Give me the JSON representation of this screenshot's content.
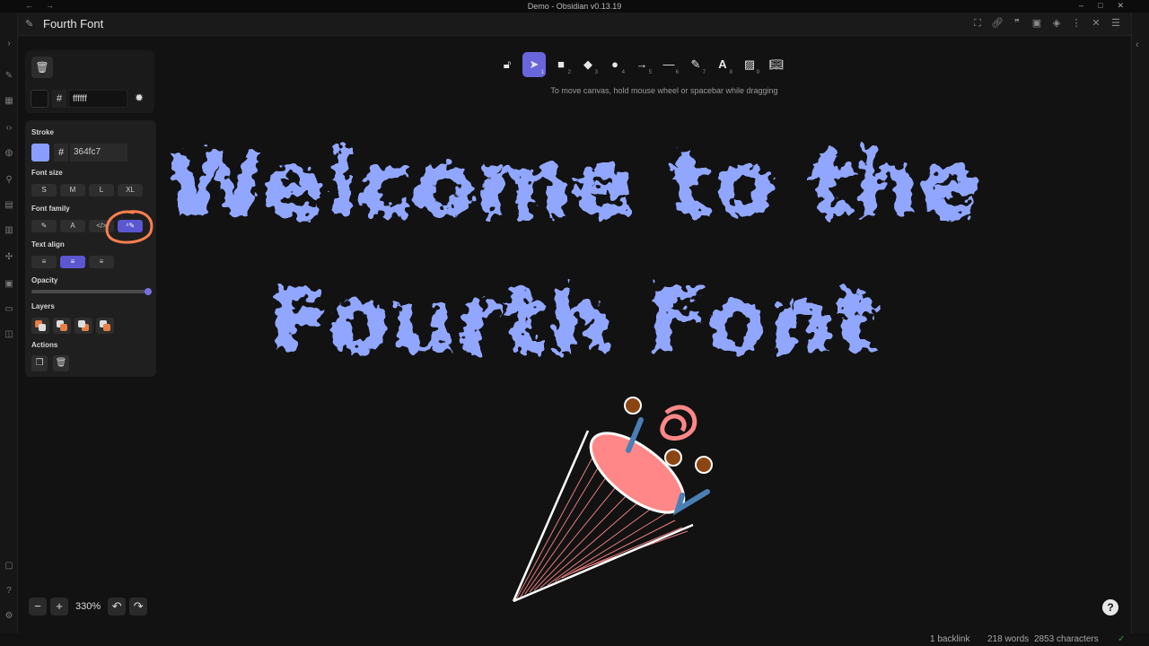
{
  "window": {
    "title": "Demo - Obsidian v0.13.19"
  },
  "file": {
    "title": "Fourth Font"
  },
  "toolbar": {
    "hint": "To move canvas, hold mouse wheel or spacebar while dragging",
    "tools": [
      {
        "icon": "lock-icon",
        "key": ""
      },
      {
        "icon": "pointer-icon",
        "key": "1"
      },
      {
        "icon": "rectangle-icon",
        "key": "2"
      },
      {
        "icon": "diamond-icon",
        "key": "3"
      },
      {
        "icon": "ellipse-icon",
        "key": "4"
      },
      {
        "icon": "arrow-icon",
        "key": "5"
      },
      {
        "icon": "line-icon",
        "key": "6"
      },
      {
        "icon": "pencil-icon",
        "key": "7"
      },
      {
        "icon": "text-icon",
        "key": "8"
      },
      {
        "icon": "image-icon",
        "key": "9"
      },
      {
        "icon": "library-icon",
        "key": ""
      }
    ]
  },
  "background": {
    "hash": "#",
    "value": "ffffff"
  },
  "props": {
    "stroke_label": "Stroke",
    "stroke_hash": "#",
    "stroke_value": "364fc7",
    "stroke_color": "#364fc7",
    "font_size_label": "Font size",
    "font_sizes": [
      "S",
      "M",
      "L",
      "XL"
    ],
    "font_family_label": "Font family",
    "text_align_label": "Text align",
    "opacity_label": "Opacity",
    "layers_label": "Layers",
    "actions_label": "Actions"
  },
  "canvas": {
    "line1": "Welcome to the",
    "line2": "Fourth Font",
    "text_color": "#91a7ff"
  },
  "zoom": {
    "level": "330%"
  },
  "status": {
    "backlinks": "1 backlink",
    "words": "218 words",
    "characters": "2853 characters"
  },
  "colors": {
    "accent": "#6965db",
    "highlight_circle": "#ff7f50"
  }
}
